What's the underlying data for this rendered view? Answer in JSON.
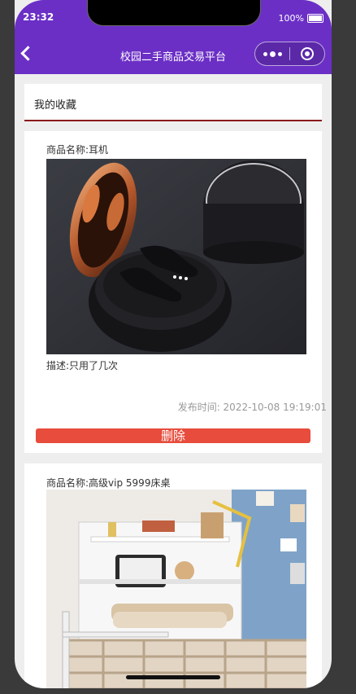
{
  "status": {
    "time": "23:32",
    "battery": "100%"
  },
  "navbar": {
    "title": "校园二手商品交易平台"
  },
  "section": {
    "title": "我的收藏"
  },
  "items": [
    {
      "name": "商品名称:耳机",
      "description": "描述:只用了几次",
      "published": "发布时间: 2022-10-08 19:19:01",
      "delete_label": "删除"
    },
    {
      "name": "商品名称:高级vip 5999床桌"
    }
  ],
  "colors": {
    "accent": "#6b2fc6",
    "danger": "#e74c3c"
  }
}
